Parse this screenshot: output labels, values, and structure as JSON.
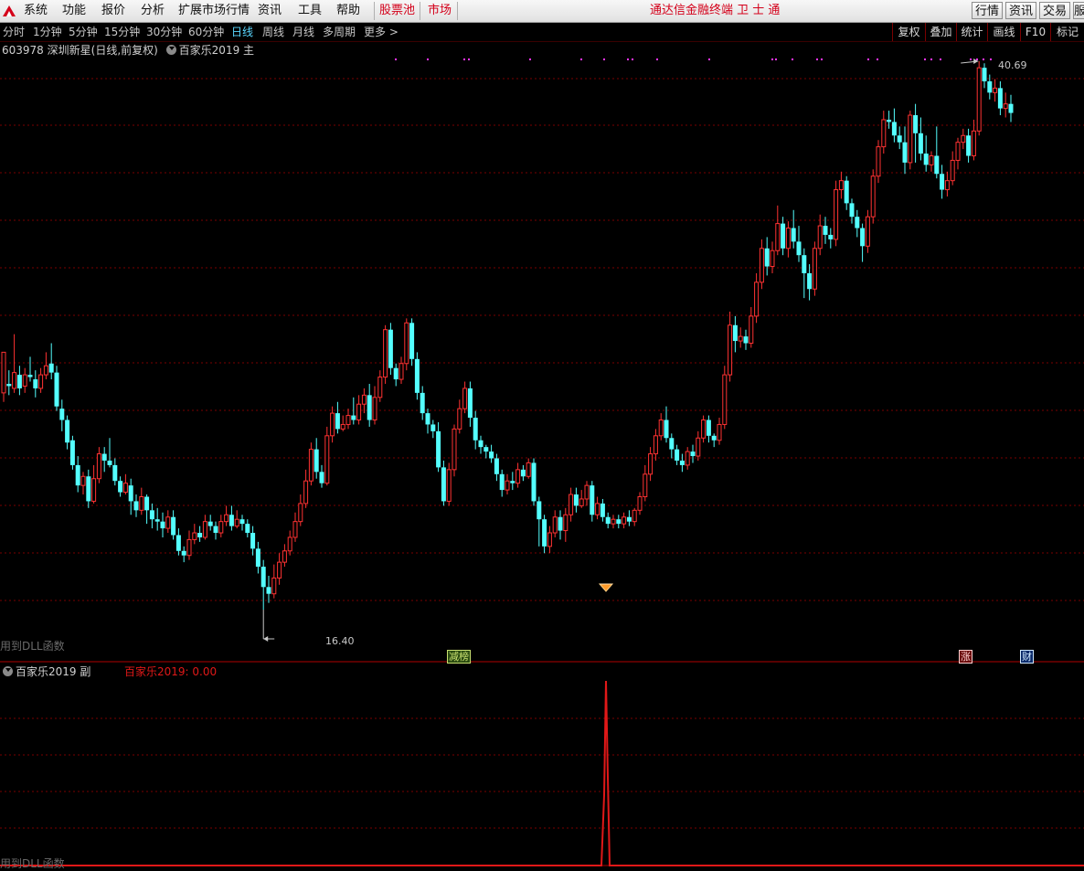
{
  "menu": {
    "items": [
      "系统",
      "功能",
      "报价",
      "分析",
      "扩展市场行情",
      "资讯",
      "工具",
      "帮助"
    ],
    "stock_pool": "股票池",
    "market": "市场",
    "app_title": "通达信金融终端  卫 士 通",
    "right_buttons": [
      "行情",
      "资讯",
      "交易",
      "服"
    ]
  },
  "toolbar": {
    "periods": [
      "分时",
      "1分钟",
      "5分钟",
      "15分钟",
      "30分钟",
      "60分钟",
      "日线",
      "周线",
      "月线",
      "多周期",
      "更多 >"
    ],
    "active_period": "日线",
    "right_buttons": [
      "复权",
      "叠加",
      "统计",
      "画线",
      "F10",
      "标记"
    ]
  },
  "stock": {
    "code": "603978",
    "name": "深圳新星",
    "mode": "(日线,前复权)",
    "indicator_main": "百家乐2019 主"
  },
  "main_chart": {
    "high_label": "40.69",
    "low_label": "16.40",
    "hint": "用到DLL函数",
    "badges": [
      {
        "text": "减榜",
        "color": "#c8e070",
        "bg": "#2a4a10"
      },
      {
        "text": "涨",
        "color": "#ffd0d0",
        "bg": "#6a0a0a"
      },
      {
        "text": "财",
        "color": "#d0e8ff",
        "bg": "#0a2a6a"
      }
    ],
    "colors": {
      "up": "#ff3232",
      "down": "#54ffff",
      "grid": "#7a0000",
      "signal": "#ff33ff",
      "diamond": "#ff9a2a"
    }
  },
  "sub_chart": {
    "title": "百家乐2019 副",
    "value_label": "百家乐2019: 0.00",
    "hint": "用到DLL函数",
    "line_color": "#e01818"
  },
  "chart_data": {
    "type": "candlestick",
    "y_range_visible": [
      16.4,
      40.69
    ],
    "candles": [
      [
        26.0,
        27.8,
        26.3,
        25.6
      ],
      [
        26.4,
        26.3,
        27.0,
        25.9
      ],
      [
        26.2,
        26.9,
        28.6,
        26.0
      ],
      [
        26.8,
        26.2,
        27.2,
        25.9
      ],
      [
        26.3,
        26.8,
        27.1,
        26.0
      ],
      [
        26.8,
        26.7,
        27.6,
        26.5
      ],
      [
        26.6,
        26.2,
        27.0,
        25.8
      ],
      [
        26.2,
        26.8,
        27.1,
        26.0
      ],
      [
        26.8,
        27.2,
        27.8,
        26.6
      ],
      [
        27.3,
        26.9,
        28.2,
        26.6
      ],
      [
        26.9,
        25.4,
        27.2,
        25.2
      ],
      [
        25.3,
        24.8,
        25.7,
        24.3
      ],
      [
        24.8,
        23.8,
        25.0,
        23.5
      ],
      [
        23.9,
        22.8,
        24.1,
        22.6
      ],
      [
        22.8,
        21.9,
        23.2,
        21.6
      ],
      [
        21.9,
        22.3,
        22.5,
        21.5
      ],
      [
        22.3,
        21.2,
        22.6,
        20.9
      ],
      [
        21.2,
        22.2,
        22.8,
        21.1
      ],
      [
        22.2,
        23.3,
        23.6,
        22.0
      ],
      [
        23.3,
        23.0,
        23.6,
        22.5
      ],
      [
        23.0,
        22.8,
        24.0,
        22.7
      ],
      [
        22.8,
        22.1,
        23.1,
        21.9
      ],
      [
        22.1,
        21.6,
        22.3,
        21.4
      ],
      [
        21.6,
        22.0,
        22.4,
        21.5
      ],
      [
        21.9,
        21.2,
        22.2,
        20.6
      ],
      [
        21.2,
        20.8,
        21.5,
        20.5
      ],
      [
        20.8,
        21.4,
        21.8,
        20.6
      ],
      [
        21.4,
        20.8,
        21.5,
        20.2
      ],
      [
        20.8,
        20.4,
        21.1,
        20.0
      ],
      [
        20.4,
        20.3,
        20.9,
        19.9
      ],
      [
        20.3,
        20.0,
        20.7,
        19.6
      ],
      [
        20.0,
        20.5,
        20.8,
        19.8
      ],
      [
        20.5,
        19.7,
        20.8,
        19.5
      ],
      [
        19.7,
        19.0,
        20.0,
        18.8
      ],
      [
        19.0,
        18.8,
        19.2,
        18.5
      ],
      [
        18.8,
        19.5,
        19.9,
        18.6
      ],
      [
        19.5,
        19.8,
        20.2,
        19.3
      ],
      [
        19.8,
        19.6,
        20.1,
        19.4
      ],
      [
        19.6,
        20.3,
        20.6,
        19.5
      ],
      [
        20.3,
        20.1,
        20.6,
        19.9
      ],
      [
        20.1,
        19.8,
        20.3,
        19.5
      ],
      [
        19.8,
        20.3,
        20.6,
        19.6
      ],
      [
        20.3,
        20.6,
        21.0,
        20.1
      ],
      [
        20.6,
        20.1,
        21.0,
        19.9
      ],
      [
        20.1,
        20.4,
        20.8,
        20.0
      ],
      [
        20.4,
        20.2,
        20.6,
        19.9
      ],
      [
        20.2,
        19.8,
        20.4,
        19.6
      ],
      [
        19.8,
        19.1,
        20.1,
        18.8
      ],
      [
        19.1,
        18.3,
        19.4,
        18.0
      ],
      [
        18.3,
        17.4,
        18.6,
        16.4
      ],
      [
        17.4,
        17.1,
        17.9,
        16.7
      ],
      [
        17.1,
        17.8,
        18.4,
        16.9
      ],
      [
        17.8,
        18.5,
        18.9,
        17.5
      ],
      [
        18.5,
        19.0,
        19.3,
        18.3
      ],
      [
        19.0,
        19.6,
        19.9,
        18.8
      ],
      [
        19.6,
        20.3,
        20.7,
        19.4
      ],
      [
        20.3,
        21.1,
        21.5,
        20.1
      ],
      [
        21.1,
        22.1,
        22.6,
        20.9
      ],
      [
        22.1,
        23.5,
        23.8,
        21.9
      ],
      [
        23.5,
        22.5,
        24.0,
        22.2
      ],
      [
        22.5,
        22.0,
        22.8,
        21.8
      ],
      [
        22.0,
        24.1,
        24.5,
        21.9
      ],
      [
        24.1,
        25.1,
        25.4,
        23.8
      ],
      [
        25.1,
        24.4,
        25.6,
        24.2
      ],
      [
        24.4,
        24.6,
        25.0,
        24.3
      ],
      [
        24.6,
        25.0,
        25.3,
        24.4
      ],
      [
        25.0,
        24.8,
        25.8,
        24.6
      ],
      [
        24.8,
        25.5,
        25.9,
        24.6
      ],
      [
        25.5,
        25.9,
        26.2,
        25.1
      ],
      [
        25.9,
        24.8,
        26.4,
        24.5
      ],
      [
        24.8,
        25.8,
        26.3,
        24.6
      ],
      [
        25.8,
        26.7,
        27.0,
        25.6
      ],
      [
        26.7,
        28.8,
        29.0,
        26.4
      ],
      [
        28.8,
        27.1,
        29.1,
        26.8
      ],
      [
        27.1,
        26.6,
        27.3,
        26.3
      ],
      [
        26.6,
        27.3,
        27.6,
        26.4
      ],
      [
        27.3,
        29.1,
        29.3,
        27.0
      ],
      [
        29.1,
        27.5,
        29.3,
        27.2
      ],
      [
        27.5,
        26.0,
        27.8,
        25.7
      ],
      [
        26.0,
        25.1,
        26.3,
        24.8
      ],
      [
        25.1,
        24.6,
        25.3,
        24.2
      ],
      [
        24.6,
        24.3,
        24.8,
        24.0
      ],
      [
        24.3,
        22.7,
        24.7,
        22.5
      ],
      [
        22.7,
        21.2,
        23.0,
        21.0
      ],
      [
        21.2,
        22.6,
        22.9,
        21.0
      ],
      [
        22.6,
        24.4,
        24.6,
        22.3
      ],
      [
        24.4,
        25.3,
        25.7,
        24.2
      ],
      [
        25.3,
        26.2,
        26.5,
        25.1
      ],
      [
        26.2,
        24.9,
        26.5,
        24.5
      ],
      [
        24.9,
        23.9,
        25.2,
        23.5
      ],
      [
        23.9,
        23.6,
        24.1,
        23.3
      ],
      [
        23.6,
        23.4,
        23.7,
        23.1
      ],
      [
        23.4,
        23.1,
        23.7,
        22.9
      ],
      [
        23.1,
        22.4,
        23.3,
        22.1
      ],
      [
        22.4,
        21.7,
        22.6,
        21.4
      ],
      [
        21.7,
        22.1,
        22.4,
        21.5
      ],
      [
        22.1,
        22.0,
        22.5,
        21.7
      ],
      [
        22.0,
        22.6,
        22.9,
        21.8
      ],
      [
        22.6,
        22.3,
        22.8,
        22.1
      ],
      [
        22.3,
        22.9,
        23.1,
        22.2
      ],
      [
        22.9,
        21.2,
        23.1,
        21.0
      ],
      [
        21.2,
        20.4,
        21.4,
        19.2
      ],
      [
        20.4,
        19.2,
        20.6,
        18.9
      ],
      [
        19.2,
        19.8,
        20.1,
        18.9
      ],
      [
        19.8,
        20.5,
        20.8,
        19.6
      ],
      [
        20.5,
        19.9,
        20.8,
        19.5
      ],
      [
        19.9,
        20.6,
        20.9,
        19.4
      ],
      [
        20.6,
        21.5,
        21.8,
        20.3
      ],
      [
        21.5,
        21.0,
        21.8,
        20.7
      ],
      [
        21.0,
        21.3,
        21.7,
        20.9
      ],
      [
        21.3,
        21.9,
        22.1,
        21.0
      ],
      [
        21.9,
        20.6,
        22.1,
        20.3
      ],
      [
        20.6,
        21.1,
        21.4,
        20.4
      ],
      [
        21.1,
        20.5,
        21.3,
        20.3
      ],
      [
        20.5,
        20.2,
        20.7,
        20.0
      ],
      [
        20.2,
        20.4,
        20.6,
        20.0
      ],
      [
        20.4,
        20.2,
        20.6,
        20.0
      ],
      [
        20.2,
        20.5,
        20.7,
        20.0
      ],
      [
        20.5,
        20.3,
        20.8,
        20.1
      ],
      [
        20.3,
        20.8,
        20.9,
        20.1
      ],
      [
        20.8,
        21.4,
        21.6,
        20.6
      ],
      [
        21.4,
        22.4,
        22.8,
        21.2
      ],
      [
        22.4,
        23.3,
        23.6,
        22.1
      ],
      [
        23.3,
        24.1,
        24.4,
        23.0
      ],
      [
        24.1,
        24.8,
        25.1,
        23.9
      ],
      [
        24.8,
        24.0,
        25.4,
        23.8
      ],
      [
        24.0,
        23.5,
        24.2,
        23.1
      ],
      [
        23.5,
        23.0,
        23.7,
        22.8
      ],
      [
        23.0,
        22.8,
        23.3,
        22.5
      ],
      [
        22.8,
        23.4,
        23.6,
        22.6
      ],
      [
        23.4,
        23.2,
        23.7,
        22.9
      ],
      [
        23.2,
        24.0,
        24.3,
        23.0
      ],
      [
        24.0,
        24.8,
        25.0,
        23.8
      ],
      [
        24.8,
        24.1,
        25.0,
        23.8
      ],
      [
        24.1,
        23.9,
        24.2,
        23.6
      ],
      [
        23.9,
        24.6,
        24.9,
        23.7
      ],
      [
        24.6,
        26.8,
        27.2,
        24.4
      ],
      [
        26.8,
        29.0,
        29.6,
        26.5
      ],
      [
        29.0,
        28.3,
        29.4,
        27.8
      ],
      [
        28.3,
        28.5,
        28.9,
        28.0
      ],
      [
        28.5,
        28.2,
        28.8,
        27.9
      ],
      [
        28.2,
        29.4,
        29.8,
        28.0
      ],
      [
        29.4,
        30.9,
        31.3,
        29.1
      ],
      [
        30.9,
        32.4,
        32.8,
        30.6
      ],
      [
        32.4,
        31.6,
        32.9,
        31.2
      ],
      [
        31.6,
        32.3,
        32.7,
        31.3
      ],
      [
        32.3,
        33.5,
        34.3,
        32.1
      ],
      [
        33.5,
        32.4,
        33.8,
        32.1
      ],
      [
        32.4,
        33.3,
        33.6,
        32.0
      ],
      [
        33.3,
        32.7,
        34.1,
        32.4
      ],
      [
        32.7,
        32.1,
        33.4,
        31.8
      ],
      [
        32.1,
        31.3,
        32.4,
        30.2
      ],
      [
        31.3,
        30.6,
        31.7,
        30.1
      ],
      [
        30.6,
        32.4,
        32.7,
        30.3
      ],
      [
        32.4,
        33.4,
        33.9,
        32.1
      ],
      [
        33.4,
        33.0,
        33.8,
        32.6
      ],
      [
        33.0,
        32.8,
        33.3,
        32.4
      ],
      [
        32.8,
        35.0,
        35.4,
        32.5
      ],
      [
        35.0,
        35.4,
        35.8,
        34.6
      ],
      [
        35.4,
        34.4,
        35.6,
        34.1
      ],
      [
        34.4,
        33.8,
        34.6,
        33.5
      ],
      [
        33.8,
        33.3,
        34.1,
        32.9
      ],
      [
        33.3,
        32.5,
        33.5,
        31.8
      ],
      [
        32.5,
        33.8,
        34.1,
        32.2
      ],
      [
        33.8,
        35.6,
        35.9,
        33.5
      ],
      [
        35.6,
        36.9,
        37.2,
        35.3
      ],
      [
        36.9,
        38.1,
        38.5,
        36.6
      ],
      [
        38.1,
        38.0,
        38.5,
        37.7
      ],
      [
        38.0,
        37.4,
        38.6,
        37.1
      ],
      [
        37.4,
        37.1,
        37.8,
        36.8
      ],
      [
        37.1,
        36.2,
        37.8,
        35.7
      ],
      [
        36.2,
        38.3,
        38.5,
        35.9
      ],
      [
        38.3,
        37.5,
        38.8,
        36.2
      ],
      [
        37.5,
        36.6,
        38.2,
        36.3
      ],
      [
        36.6,
        36.1,
        37.4,
        35.8
      ],
      [
        36.1,
        36.5,
        36.7,
        35.8
      ],
      [
        36.5,
        35.7,
        37.8,
        35.5
      ],
      [
        35.7,
        35.0,
        36.1,
        34.6
      ],
      [
        35.0,
        35.4,
        35.8,
        34.7
      ],
      [
        35.4,
        36.3,
        36.7,
        35.2
      ],
      [
        36.3,
        37.1,
        37.3,
        35.9
      ],
      [
        37.1,
        37.4,
        37.7,
        36.8
      ],
      [
        37.4,
        36.5,
        37.7,
        36.2
      ],
      [
        36.5,
        37.6,
        38.1,
        36.3
      ],
      [
        37.6,
        40.4,
        40.69,
        37.4
      ],
      [
        40.4,
        39.8,
        40.6,
        39.5
      ],
      [
        39.8,
        39.3,
        40.1,
        39.0
      ],
      [
        39.3,
        39.5,
        39.9,
        38.9
      ],
      [
        39.5,
        38.6,
        39.8,
        38.3
      ],
      [
        38.6,
        38.8,
        39.3,
        38.2
      ],
      [
        38.8,
        38.4,
        39.2,
        38.0
      ]
    ],
    "sub_indicator": {
      "name": "百家乐2019",
      "value": 0.0
    }
  }
}
